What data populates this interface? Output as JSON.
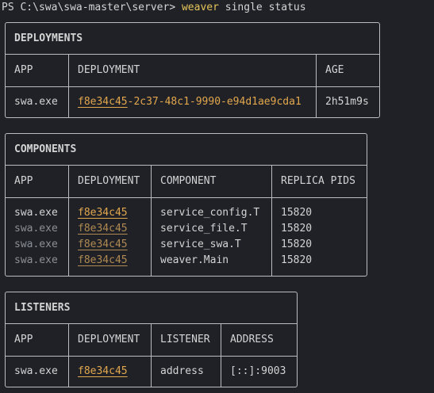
{
  "prompt": {
    "path": "PS C:\\swa\\swa-master\\server> ",
    "command": "weaver",
    "args": " single status"
  },
  "deployments": {
    "title": "DEPLOYMENTS",
    "headers": [
      "APP",
      "DEPLOYMENT",
      "AGE"
    ],
    "row": {
      "app": "swa.exe",
      "hash": "f8e34c45",
      "rest": "-2c37-48c1-9990-e94d1ae9cda1",
      "age": "2h51m9s"
    }
  },
  "components": {
    "title": "COMPONENTS",
    "headers": [
      "APP",
      "DEPLOYMENT",
      "COMPONENT",
      "REPLICA PIDS"
    ],
    "rows": [
      {
        "app": "swa.exe",
        "deployment": "f8e34c45",
        "component": "service_config.T",
        "pids": "15820"
      },
      {
        "app": "swa.exe",
        "deployment": "f8e34c45",
        "component": "service_file.T",
        "pids": "15820"
      },
      {
        "app": "swa.exe",
        "deployment": "f8e34c45",
        "component": "service_swa.T",
        "pids": "15820"
      },
      {
        "app": "swa.exe",
        "deployment": "f8e34c45",
        "component": "weaver.Main",
        "pids": "15820"
      }
    ]
  },
  "listeners": {
    "title": "LISTENERS",
    "headers": [
      "APP",
      "DEPLOYMENT",
      "LISTENER",
      "ADDRESS"
    ],
    "row": {
      "app": "swa.exe",
      "deployment": "f8e34c45",
      "listener": "address",
      "address": "[::]:9003"
    }
  },
  "colors": {
    "background": "#1f2127",
    "command": "#e5c45a",
    "deployment_id": "#e2a74d",
    "border": "#b9bcc2"
  }
}
